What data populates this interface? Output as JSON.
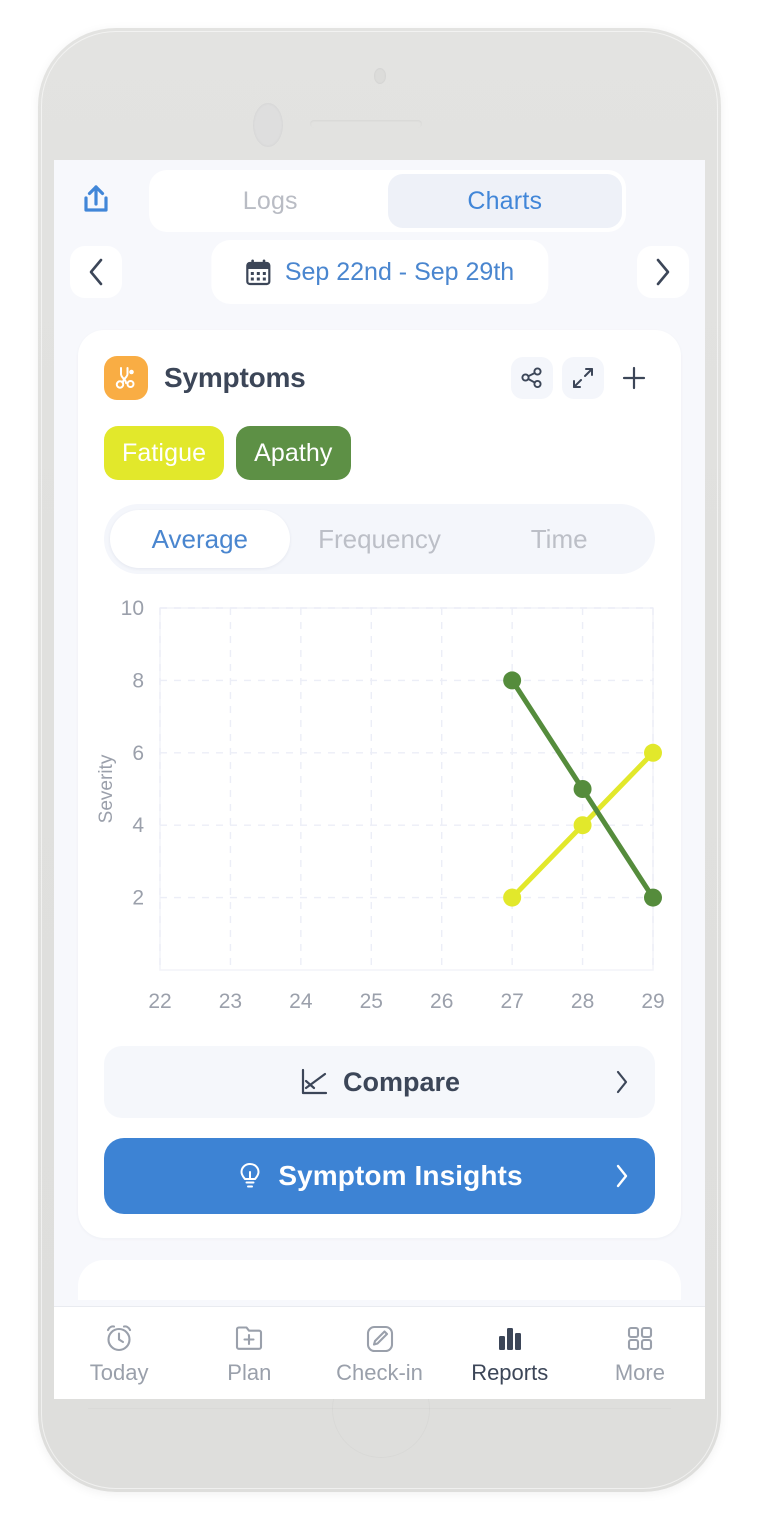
{
  "app": {
    "screen_title": "Reports - Charts"
  },
  "top_bar": {
    "export_icon": "share-export-icon",
    "tabs": [
      {
        "label": "Logs",
        "active": false
      },
      {
        "label": "Charts",
        "active": true
      }
    ]
  },
  "date_nav": {
    "prev_icon": "chevron-left-icon",
    "next_icon": "chevron-right-icon",
    "calendar_icon": "calendar-icon",
    "range_label": "Sep 22nd - Sep 29th"
  },
  "card": {
    "icon": "symptoms-icon",
    "icon_bg": "#f9ad44",
    "title": "Symptoms",
    "actions": [
      {
        "name": "share-icon",
        "label": "Share"
      },
      {
        "name": "expand-icon",
        "label": "Expand"
      },
      {
        "name": "plus-icon",
        "label": "Add"
      }
    ],
    "symptom_pills": [
      {
        "label": "Fatigue",
        "color": "#e2e82b",
        "selected": true
      },
      {
        "label": "Apathy",
        "color": "#5d9045",
        "selected": true
      }
    ],
    "mode_tabs": [
      {
        "label": "Average",
        "active": true
      },
      {
        "label": "Frequency",
        "active": false
      },
      {
        "label": "Time",
        "active": false
      }
    ],
    "compare": {
      "icon": "compare-chart-icon",
      "label": "Compare",
      "chevron": "chevron-right-icon"
    },
    "insights": {
      "icon": "lightbulb-icon",
      "label": "Symptom Insights",
      "chevron": "chevron-right-icon",
      "color": "#3d83d4"
    }
  },
  "chart_data": {
    "type": "line",
    "title": "",
    "xlabel": "",
    "ylabel": "Severity",
    "x": [
      22,
      23,
      24,
      25,
      26,
      27,
      28,
      29
    ],
    "xtick_labels": [
      "22",
      "23",
      "24",
      "25",
      "26",
      "27",
      "28",
      "29"
    ],
    "ytick_labels": [
      "2",
      "4",
      "6",
      "8",
      "10"
    ],
    "yticks": [
      2,
      4,
      6,
      8,
      10
    ],
    "ylim": [
      0,
      10
    ],
    "grid": true,
    "grid_style": "dashed",
    "legend": "none",
    "series": [
      {
        "name": "Fatigue",
        "color": "#e2e82b",
        "x": [
          27,
          28,
          29
        ],
        "values": [
          2,
          4,
          6
        ]
      },
      {
        "name": "Apathy",
        "color": "#558c3c",
        "x": [
          27,
          28,
          29
        ],
        "values": [
          8,
          5,
          2
        ]
      }
    ]
  },
  "bottom_nav": [
    {
      "label": "Today",
      "icon": "alarm-clock-icon",
      "active": false
    },
    {
      "label": "Plan",
      "icon": "folder-plus-icon",
      "active": false
    },
    {
      "label": "Check-in",
      "icon": "pencil-square-icon",
      "active": false
    },
    {
      "label": "Reports",
      "icon": "bar-chart-icon",
      "active": true
    },
    {
      "label": "More",
      "icon": "grid-icon",
      "active": false
    }
  ]
}
